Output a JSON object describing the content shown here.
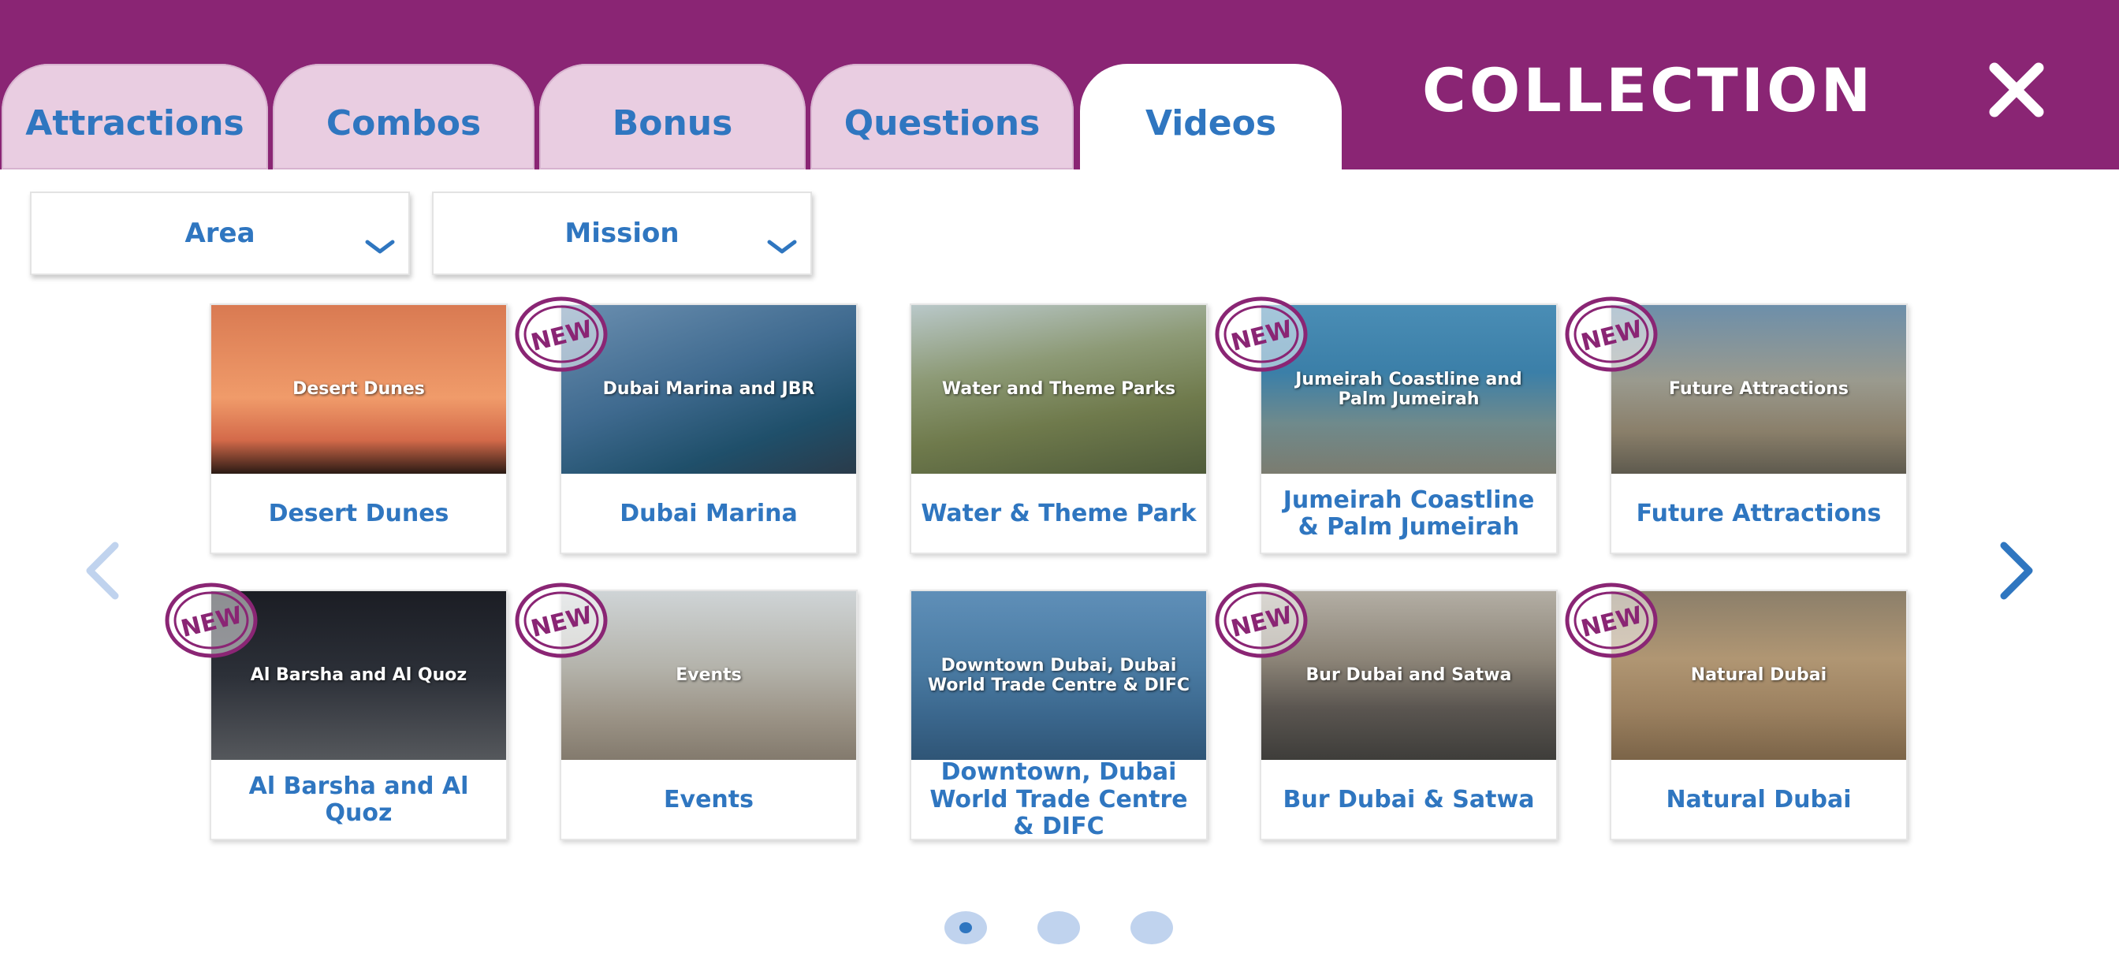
{
  "header": {
    "title": "COLLECTION",
    "background": "#8a2574",
    "tabs": [
      {
        "label": "Attractions",
        "active": false
      },
      {
        "label": "Combos",
        "active": false
      },
      {
        "label": "Bonus",
        "active": false
      },
      {
        "label": "Questions",
        "active": false
      },
      {
        "label": "Videos",
        "active": true
      }
    ],
    "close_icon": "close-icon"
  },
  "filters": {
    "area": "Area",
    "mission": "Mission"
  },
  "badge_label": "NEW",
  "cards": [
    {
      "thumb_text": "Desert Dunes",
      "caption": "Desert Dunes",
      "new": false
    },
    {
      "thumb_text": "Dubai Marina and JBR",
      "caption": "Dubai Marina",
      "new": true
    },
    {
      "thumb_text": "Water and Theme Parks",
      "caption": "Water & Theme Park",
      "new": false
    },
    {
      "thumb_text": "Jumeirah Coastline and Palm Jumeirah",
      "caption": "Jumeirah Coastline & Palm Jumeirah",
      "new": true
    },
    {
      "thumb_text": "Future Attractions",
      "caption": "Future Attractions",
      "new": true
    },
    {
      "thumb_text": "Al Barsha and Al Quoz",
      "caption": "Al Barsha and Al Quoz",
      "new": true
    },
    {
      "thumb_text": "Events",
      "caption": "Events",
      "new": true
    },
    {
      "thumb_text": "Downtown Dubai, Dubai World Trade Centre & DIFC",
      "caption": "Downtown, Dubai World Trade Centre & DIFC",
      "new": false
    },
    {
      "thumb_text": "Bur Dubai and Satwa",
      "caption": "Bur Dubai & Satwa",
      "new": true
    },
    {
      "thumb_text": "Natural Dubai",
      "caption": "Natural Dubai",
      "new": true
    }
  ],
  "pagination": {
    "pages": 3,
    "current": 1
  },
  "colors": {
    "accent": "#2f76c0",
    "brand": "#8a2574",
    "tab_inactive": "#e9cde1"
  }
}
